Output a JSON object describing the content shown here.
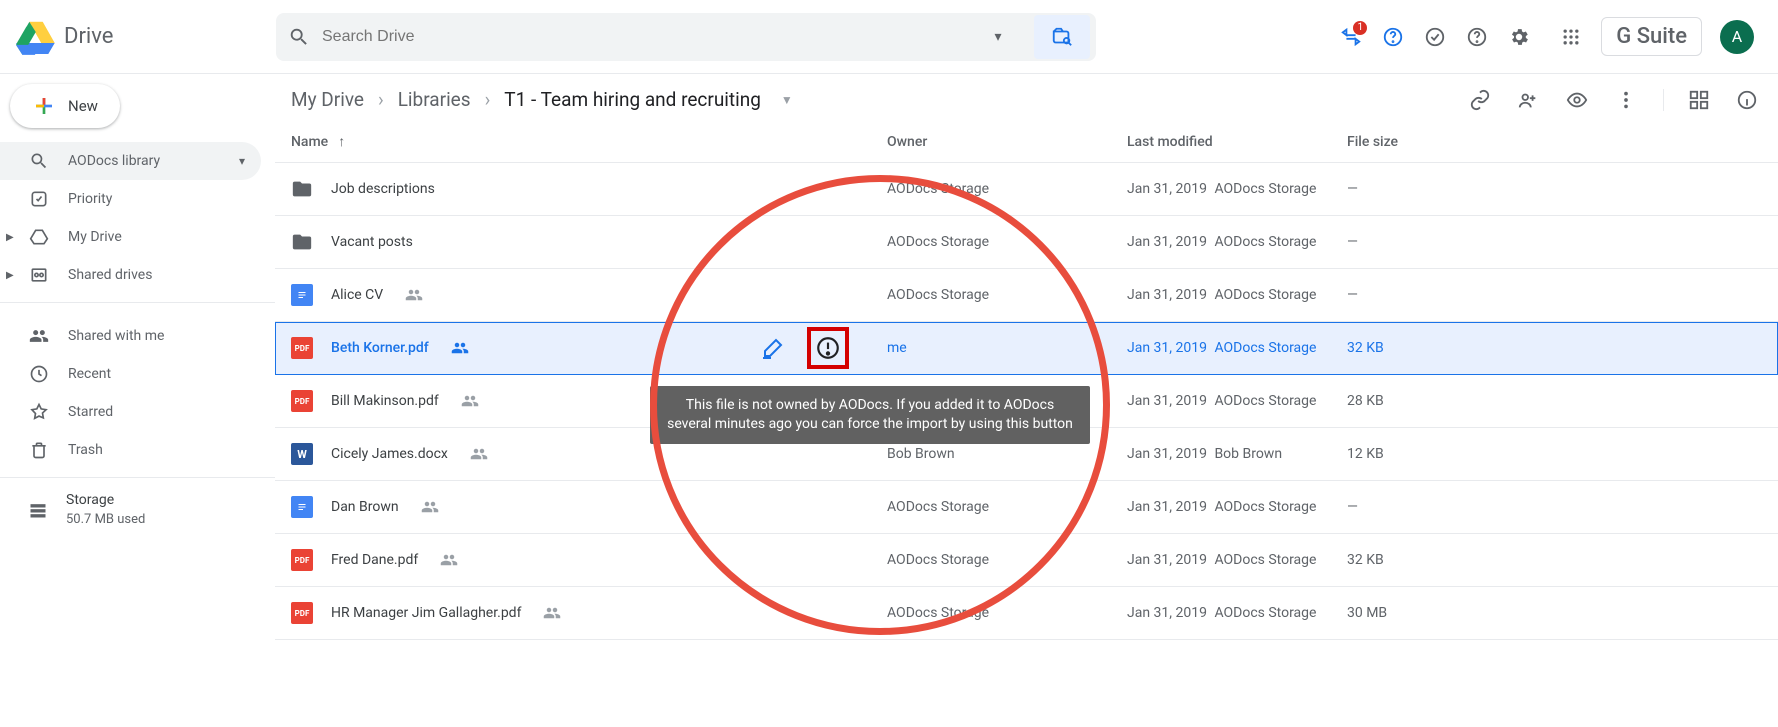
{
  "appName": "Drive",
  "search": {
    "placeholder": "Search Drive"
  },
  "headerBadge": "1",
  "gsuiteLabel": "G Suite",
  "avatarInitial": "A",
  "newButton": "New",
  "sidebar": {
    "library": "AODocs library",
    "items": [
      {
        "label": "Priority"
      },
      {
        "label": "My Drive"
      },
      {
        "label": "Shared drives"
      }
    ],
    "itemsB": [
      {
        "label": "Shared with me"
      },
      {
        "label": "Recent"
      },
      {
        "label": "Starred"
      },
      {
        "label": "Trash"
      }
    ],
    "storage": {
      "title": "Storage",
      "used": "50.7 MB used"
    }
  },
  "breadcrumbs": [
    "My Drive",
    "Libraries",
    "T1 - Team hiring and recruiting"
  ],
  "columns": {
    "name": "Name",
    "owner": "Owner",
    "modified": "Last modified",
    "size": "File size"
  },
  "rows": [
    {
      "type": "folder",
      "name": "Job descriptions",
      "owner": "AODocs Storage",
      "modified": "Jan 31, 2019",
      "modUser": "AODocs Storage",
      "size": "—",
      "shared": false
    },
    {
      "type": "folder",
      "name": "Vacant posts",
      "owner": "AODocs Storage",
      "modified": "Jan 31, 2019",
      "modUser": "AODocs Storage",
      "size": "—",
      "shared": false
    },
    {
      "type": "gdoc",
      "name": "Alice CV",
      "owner": "AODocs Storage",
      "modified": "Jan 31, 2019",
      "modUser": "AODocs Storage",
      "size": "—",
      "shared": true
    },
    {
      "type": "pdf",
      "name": "Beth Korner.pdf",
      "owner": "me",
      "modified": "Jan 31, 2019",
      "modUser": "AODocs Storage",
      "size": "32 KB",
      "shared": true,
      "selected": true
    },
    {
      "type": "pdf",
      "name": "Bill Makinson.pdf",
      "owner": "AODocs Storage",
      "modified": "Jan 31, 2019",
      "modUser": "AODocs Storage",
      "size": "28 KB",
      "shared": true
    },
    {
      "type": "word",
      "name": "Cicely James.docx",
      "owner": "Bob Brown",
      "modified": "Jan 31, 2019",
      "modUser": "Bob Brown",
      "size": "12 KB",
      "shared": true
    },
    {
      "type": "gdoc",
      "name": "Dan Brown",
      "owner": "AODocs Storage",
      "modified": "Jan 31, 2019",
      "modUser": "AODocs Storage",
      "size": "—",
      "shared": true
    },
    {
      "type": "pdf",
      "name": "Fred Dane.pdf",
      "owner": "AODocs Storage",
      "modified": "Jan 31, 2019",
      "modUser": "AODocs Storage",
      "size": "32 KB",
      "shared": true
    },
    {
      "type": "pdf",
      "name": "HR Manager Jim Gallagher.pdf",
      "owner": "AODocs Storage",
      "modified": "Jan 31, 2019",
      "modUser": "AODocs Storage",
      "size": "30 MB",
      "shared": true
    }
  ],
  "tooltip": "This file is not owned by AODocs. If you added it to AODocs several minutes ago you can force the import by using this button"
}
